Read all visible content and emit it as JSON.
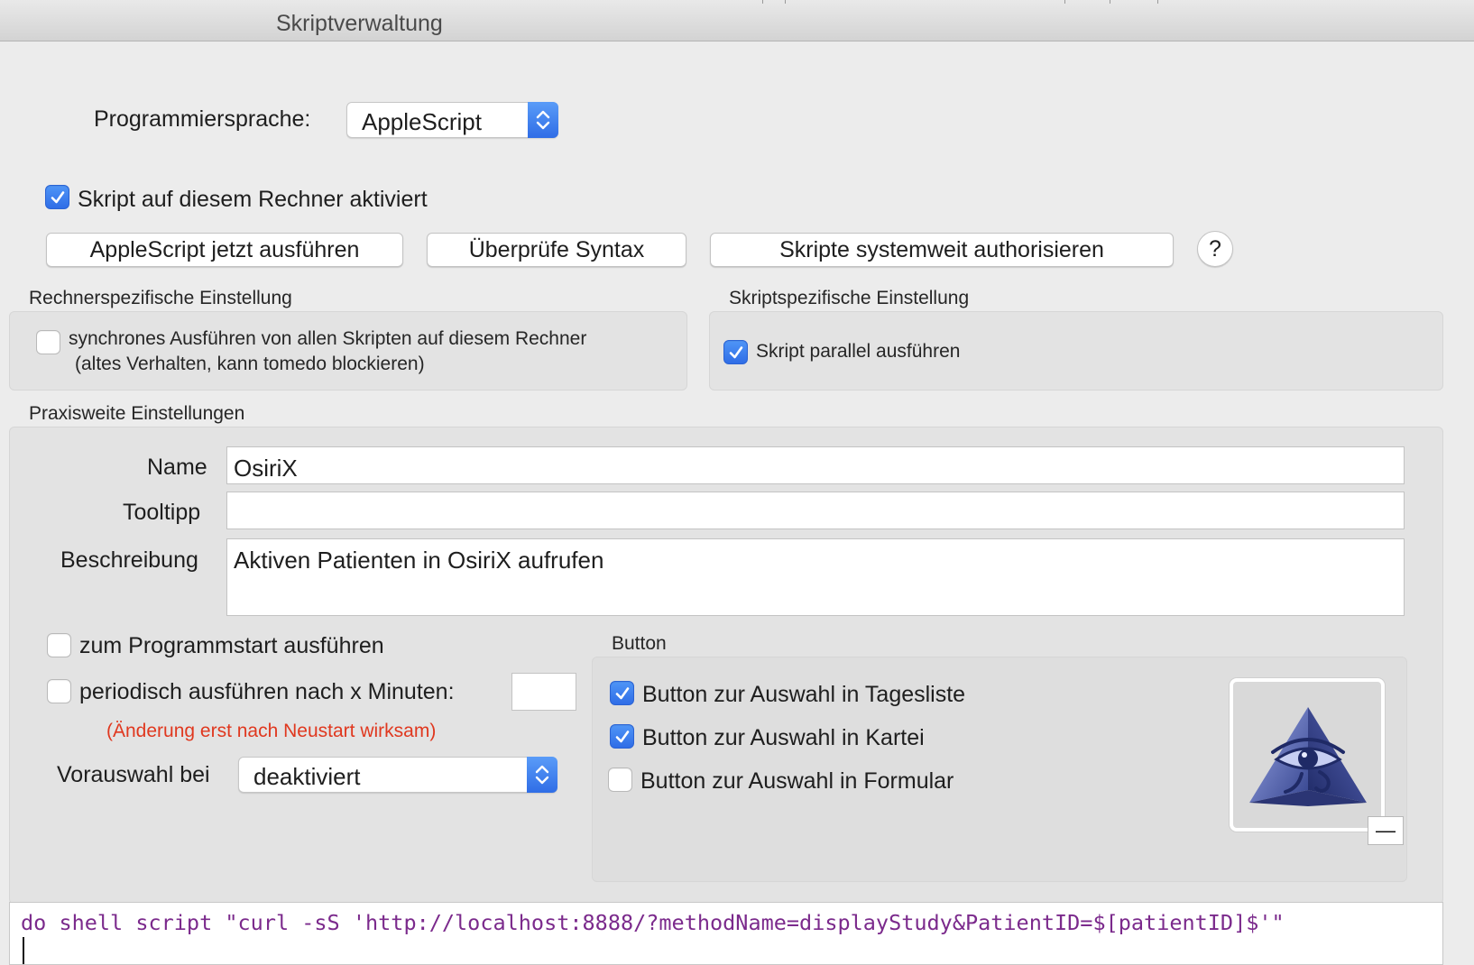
{
  "window": {
    "title": "Skriptverwaltung"
  },
  "language": {
    "label": "Programmiersprache:",
    "selected": "AppleScript"
  },
  "script_enabled": {
    "label": "Skript auf diesem Rechner aktiviert",
    "checked": true
  },
  "actions": {
    "run_label": "AppleScript jetzt ausführen",
    "check_syntax_label": "Überprüfe Syntax",
    "authorize_label": "Skripte systemweit authorisieren",
    "help_label": "?"
  },
  "machine_settings": {
    "title": "Rechnerspezifische Einstellung",
    "sync_line1": "synchrones Ausführen von allen Skripten auf diesem Rechner",
    "sync_line2": "(altes Verhalten, kann tomedo blockieren)",
    "sync_checked": false
  },
  "script_settings": {
    "title": "Skriptspezifische Einstellung",
    "parallel_label": "Skript parallel ausführen",
    "parallel_checked": true
  },
  "practice_settings": {
    "title": "Praxisweite Einstellungen",
    "name_label": "Name",
    "name_value": "OsiriX",
    "tooltip_label": "Tooltipp",
    "tooltip_value": "",
    "description_label": "Beschreibung",
    "description_value": "Aktiven Patienten in OsiriX aufrufen",
    "on_start_label": "zum Programmstart ausführen",
    "on_start_checked": false,
    "periodic_label": "periodisch ausführen nach x Minuten:",
    "periodic_checked": false,
    "periodic_minutes": "",
    "restart_hint": "(Änderung erst nach Neustart wirksam)",
    "preselect_label": "Vorauswahl bei",
    "preselect_value": "deaktiviert"
  },
  "button_group": {
    "title": "Button",
    "tagesliste_label": "Button zur Auswahl in Tagesliste",
    "tagesliste_checked": true,
    "kartei_label": "Button zur Auswahl in Kartei",
    "kartei_checked": true,
    "formular_label": "Button zur Auswahl in Formular",
    "formular_checked": false,
    "icon": "osirix-eye-pyramid-icon",
    "remove_label": "—"
  },
  "editor": {
    "code": "do shell script \"curl -sS 'http://localhost:8888/?methodName=displayStudy&PatientID=$[patientID]$'\""
  },
  "colors": {
    "accent": "#2f6de6",
    "hint_red": "#e0381f",
    "code_purple": "#7b2a8c"
  }
}
